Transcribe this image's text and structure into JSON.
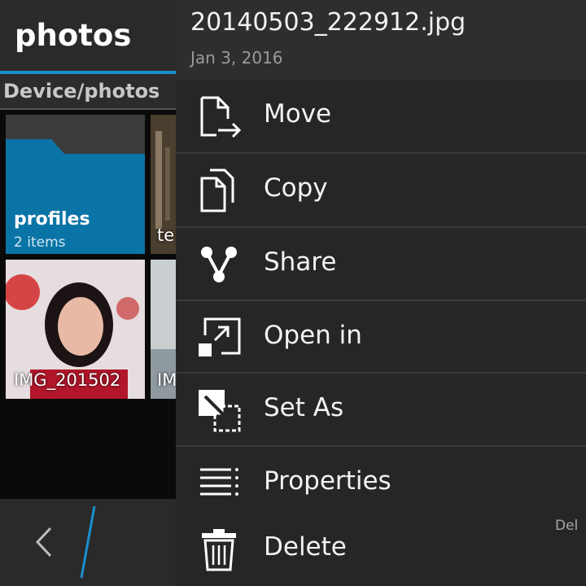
{
  "header": {
    "title": "photos"
  },
  "breadcrumb": {
    "path": "Device/photos"
  },
  "grid": {
    "folder": {
      "name": "profiles",
      "count": "2 items"
    },
    "tiles": [
      {
        "label": "te"
      },
      {
        "label": "IMG_201502"
      },
      {
        "label": "IM"
      }
    ]
  },
  "footer": {
    "back_icon": "chevron-left-icon"
  },
  "context_menu": {
    "file_name": "20140503_222912.jpg",
    "file_date": "Jan 3, 2016",
    "items": [
      {
        "label": "Move",
        "icon": "move-icon"
      },
      {
        "label": "Copy",
        "icon": "copy-icon"
      },
      {
        "label": "Share",
        "icon": "share-icon"
      },
      {
        "label": "Open in",
        "icon": "open-in-icon"
      },
      {
        "label": "Set As",
        "icon": "set-as-icon"
      },
      {
        "label": "Properties",
        "icon": "properties-icon"
      },
      {
        "label": "Delete",
        "icon": "trash-icon"
      }
    ],
    "shortcut_hint": "Del"
  },
  "colors": {
    "accent": "#1a8fd0",
    "folder": "#0b74a6",
    "menu_bg": "#262626"
  }
}
